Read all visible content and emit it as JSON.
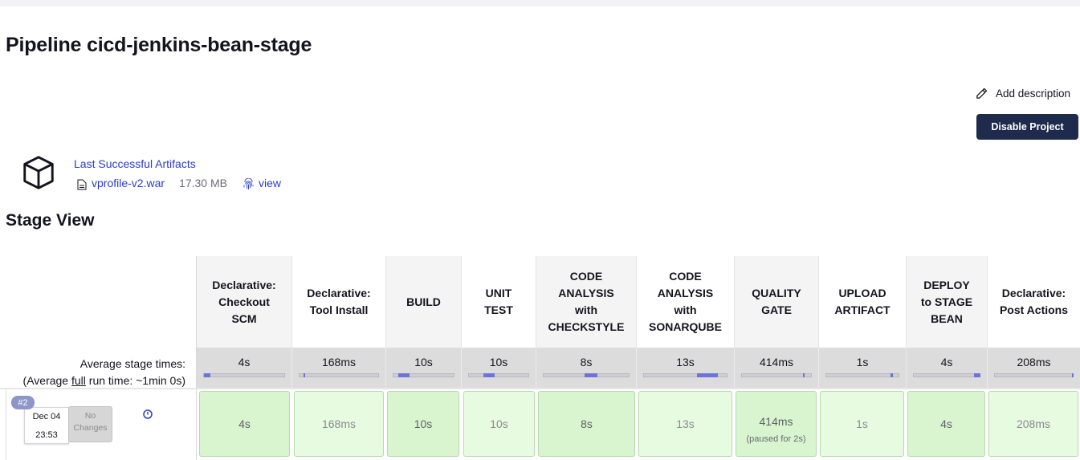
{
  "page": {
    "title": "Pipeline cicd-jenkins-bean-stage",
    "add_description": "Add description",
    "disable_project": "Disable Project"
  },
  "artifacts": {
    "title": "Last Successful Artifacts",
    "file_name": "vprofile-v2.war",
    "file_size": "17.30 MB",
    "view_label": "view"
  },
  "stage_view": {
    "title": "Stage View",
    "avg_label_line1": "Average stage times:",
    "avg_label_prefix": "(Average ",
    "avg_label_full": "full",
    "avg_label_suffix": " run time: ~1min 0s)",
    "stages": [
      {
        "name": "Declarative: Checkout SCM",
        "avg": "4s",
        "result": "4s",
        "shade": "dark"
      },
      {
        "name": "Declarative: Tool Install",
        "avg": "168ms",
        "result": "168ms",
        "shade": "light"
      },
      {
        "name": "BUILD",
        "avg": "10s",
        "result": "10s",
        "shade": "dark"
      },
      {
        "name": "UNIT TEST",
        "avg": "10s",
        "result": "10s",
        "shade": "dark"
      },
      {
        "name": "CODE ANALYSIS with CHECKSTYLE",
        "avg": "8s",
        "result": "8s",
        "shade": "dark"
      },
      {
        "name": "CODE ANALYSIS with SONARQUBE",
        "avg": "13s",
        "result": "13s",
        "shade": "dark"
      },
      {
        "name": "QUALITY GATE",
        "avg": "414ms",
        "result": "414ms",
        "note": "(paused for 2s)",
        "shade": "light"
      },
      {
        "name": "UPLOAD ARTIFACT",
        "avg": "1s",
        "result": "1s",
        "shade": "light"
      },
      {
        "name": "DEPLOY to STAGE BEAN",
        "avg": "4s",
        "result": "4s",
        "shade": "dark"
      },
      {
        "name": "Declarative: Post Actions",
        "avg": "208ms",
        "result": "208ms",
        "shade": "light"
      }
    ],
    "build": {
      "number": "#2",
      "date": "Dec 04",
      "time": "23:53",
      "changes": "No Changes"
    }
  },
  "colors": {
    "primary_button": "#1f2b4d",
    "link": "#2b3bcc",
    "success_dark": "#d8f5d0",
    "success_light": "#e7fbe1",
    "progress_fill": "#6c74d8"
  }
}
